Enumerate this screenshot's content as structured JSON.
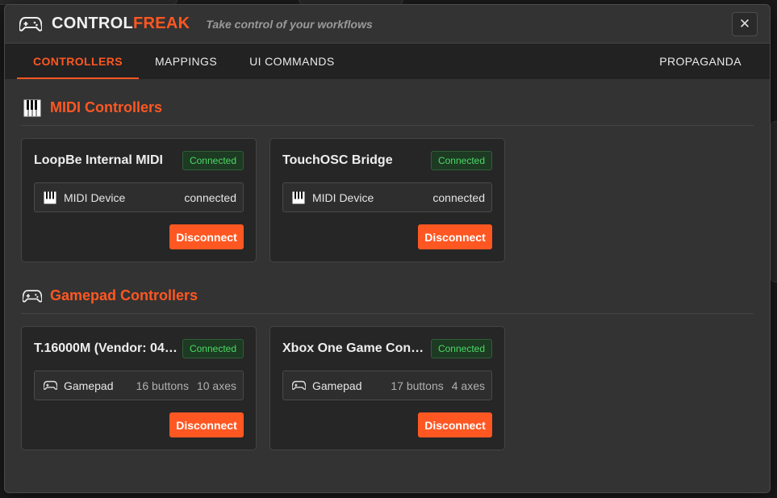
{
  "header": {
    "brand_part1": "CONTROL",
    "brand_part2": "FREAK",
    "tagline": "Take control of your workflows",
    "close_label": "✕"
  },
  "tabs": [
    {
      "label": "CONTROLLERS",
      "active": true
    },
    {
      "label": "MAPPINGS",
      "active": false
    },
    {
      "label": "UI COMMANDS",
      "active": false
    },
    {
      "label": "PROPAGANDA",
      "active": false
    }
  ],
  "sections": {
    "midi": {
      "title": "MIDI Controllers",
      "icon": "piano-keys-icon",
      "cards": [
        {
          "name": "LoopBe Internal MIDI",
          "status": "Connected",
          "device_type": "MIDI Device",
          "device_status": "connected",
          "button": "Disconnect"
        },
        {
          "name": "TouchOSC Bridge",
          "status": "Connected",
          "device_type": "MIDI Device",
          "device_status": "connected",
          "button": "Disconnect"
        }
      ]
    },
    "gamepad": {
      "title": "Gamepad Controllers",
      "icon": "gamepad-icon",
      "cards": [
        {
          "name": "T.16000M (Vendor: 04…",
          "status": "Connected",
          "device_type": "Gamepad",
          "buttons": "16 buttons",
          "axes": "10 axes",
          "button": "Disconnect"
        },
        {
          "name": "Xbox One Game Cont…",
          "status": "Connected",
          "device_type": "Gamepad",
          "buttons": "17 buttons",
          "axes": "4 axes",
          "button": "Disconnect"
        }
      ]
    }
  },
  "colors": {
    "accent": "#ff5722",
    "status_green": "#4cd964",
    "panel_bg": "#333333",
    "card_bg": "#262626"
  }
}
